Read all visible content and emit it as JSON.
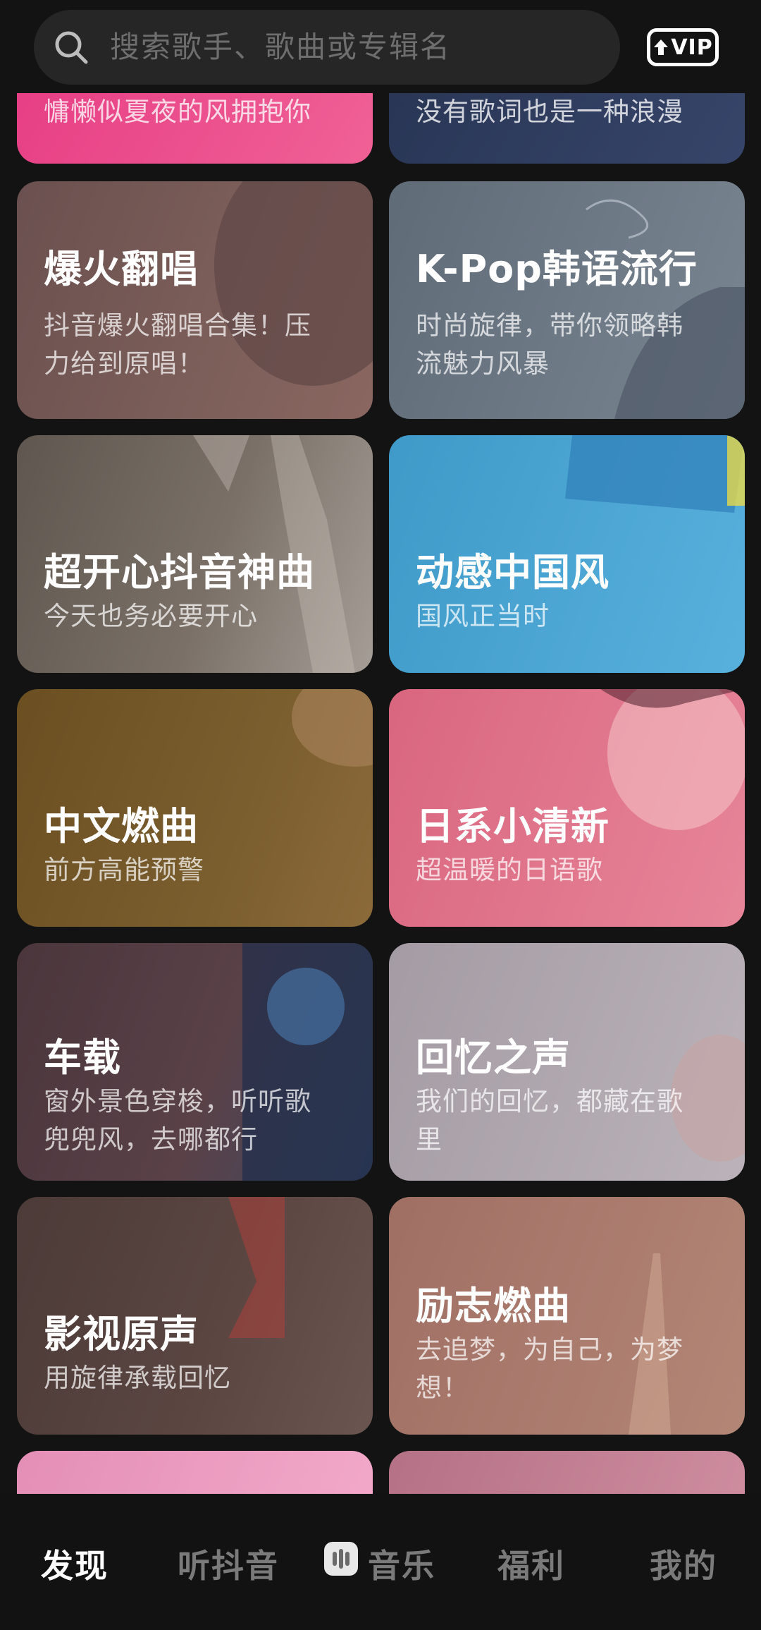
{
  "search": {
    "placeholder": "搜索歌手、歌曲或专辑名",
    "vip_label": "VIP"
  },
  "cards_top_partial": [
    {
      "subtitle": "慵懒似夏夜的风拥抱你",
      "color": "#e83a82"
    },
    {
      "subtitle": "没有歌词也是一种浪漫",
      "color": "#2c3a5e"
    }
  ],
  "cards": [
    {
      "title": "爆火翻唱",
      "subtitle": "抖音爆火翻唱合集！压力给到原唱！",
      "color": "#6e5352"
    },
    {
      "title": "K-Pop韩语流行",
      "subtitle": "时尚旋律，带你领略韩流魅力风暴",
      "color": "#66717f"
    },
    {
      "title": "超开心抖音神曲",
      "subtitle": "今天也务必要开心",
      "color": "#6b6158"
    },
    {
      "title": "动感中国风",
      "subtitle": "国风正当时",
      "color": "#4aa3cf"
    },
    {
      "title": "中文燃曲",
      "subtitle": "前方高能预警",
      "color": "#6e5326"
    },
    {
      "title": "日系小清新",
      "subtitle": "超温暖的日语歌",
      "color": "#dd6f86"
    },
    {
      "title": "车载",
      "subtitle": "窗外景色穿梭，听听歌兜兜风，去哪都行",
      "color": "#4e3a3f"
    },
    {
      "title": "回忆之声",
      "subtitle": "我们的回忆，都藏在歌里",
      "color": "#a8a0a8"
    },
    {
      "title": "影视原声",
      "subtitle": "用旋律承载回忆",
      "color": "#55433f"
    },
    {
      "title": "励志燃曲",
      "subtitle": "去追梦，为自己，为梦想！",
      "color": "#a87a6f"
    }
  ],
  "cards_bottom_partial": [
    {
      "color": "#e48fb6"
    },
    {
      "color": "#c07f92"
    }
  ],
  "bottom_nav": {
    "discover": "发现",
    "listen": "听抖音",
    "music": "音乐",
    "welfare": "福利",
    "mine": "我的"
  }
}
